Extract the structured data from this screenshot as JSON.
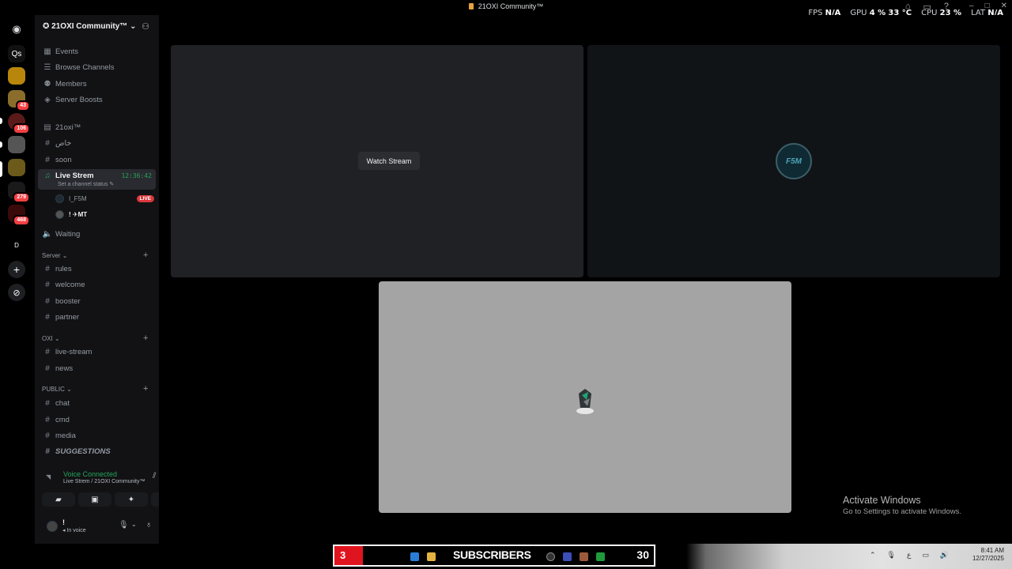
{
  "window": {
    "title": "21OXI Community™"
  },
  "overlay": {
    "fps_label": "FPS",
    "fps_value": "N/A",
    "gpu_label": "GPU",
    "gpu_util": "4 %",
    "gpu_temp": "33 °C",
    "cpu_label": "CPU",
    "cpu_util": "23 %",
    "lat_label": "LAT",
    "lat_value": "N/A"
  },
  "servers": {
    "items": [
      {
        "glyph": "Qs"
      },
      {
        "badge": "43"
      },
      {
        "badge": "106"
      },
      {
        "badge": "279"
      },
      {
        "badge": "468"
      },
      {
        "glyph": "D"
      }
    ]
  },
  "guild": {
    "name": "21OXI Community™",
    "links": [
      {
        "label": "Events"
      },
      {
        "label": "Browse Channels"
      },
      {
        "label": "Members"
      },
      {
        "label": "Server Boosts"
      }
    ],
    "channels_top": [
      {
        "label": "21oxi™"
      },
      {
        "label": "خاص"
      },
      {
        "label": "soon"
      }
    ],
    "voice": {
      "name": "Live Strem",
      "status": "Set a channel status",
      "timer": "12:36:42",
      "users": [
        {
          "name": "I_F5M",
          "badge": "LIVE"
        },
        {
          "name": "! ✈MT"
        }
      ],
      "waiting": "Waiting"
    },
    "categories": [
      {
        "name": "Server",
        "channels": [
          "rules",
          "welcome",
          "booster",
          "partner"
        ]
      },
      {
        "name": "OXI",
        "channels": [
          "live-stream",
          "news"
        ]
      },
      {
        "name": "PUBLIC",
        "channels": [
          "chat",
          "cmd",
          "media",
          "SUGGESTIONS"
        ]
      }
    ]
  },
  "voice_panel": {
    "state": "Voice Connected",
    "location": "Live Strem / 21OXI Community™",
    "user_name": "!",
    "user_status": "In voice"
  },
  "stage": {
    "watch_label": "Watch Stream",
    "f5m_logo": "F5M"
  },
  "watermark": {
    "line1": "Activate Windows",
    "line2": "Go to Settings to activate Windows."
  },
  "taskbar": {
    "subs_count": "3",
    "subs_label": "SUBSCRIBERS",
    "subs_goal": "30",
    "time": "8:41 AM",
    "date": "12/27/2025"
  },
  "colors": {
    "accent_green": "#23a55a",
    "live_red": "#da373c",
    "bg": "#121214"
  }
}
